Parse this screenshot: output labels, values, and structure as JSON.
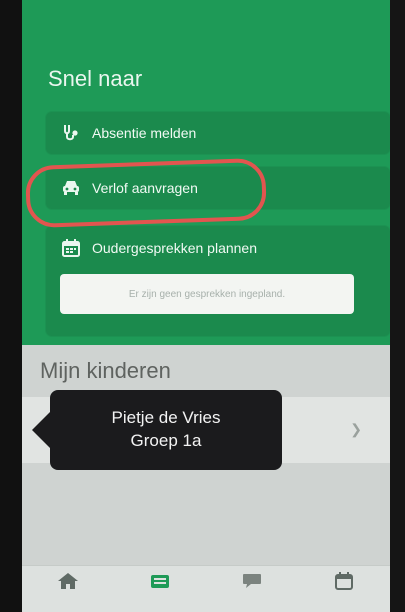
{
  "quick_links": {
    "title": "Snel naar",
    "items": [
      {
        "label": "Absentie melden",
        "icon": "stethoscope-icon"
      },
      {
        "label": "Verlof aanvragen",
        "icon": "car-icon"
      },
      {
        "label": "Oudergesprekken plannen",
        "icon": "calendar-icon",
        "empty_text": "Er zijn geen gesprekken ingepland."
      }
    ]
  },
  "children": {
    "title": "Mijn kinderen"
  },
  "tooltip": {
    "line1": "Pietje de Vries",
    "line2": "Groep 1a"
  },
  "nav": {
    "items": [
      {
        "label": "",
        "icon": "home-icon"
      },
      {
        "label": "",
        "icon": "inbox-icon"
      },
      {
        "label": "",
        "icon": "chat-icon"
      },
      {
        "label": "",
        "icon": "calendar-icon"
      }
    ]
  },
  "colors": {
    "green": "#1e9a57",
    "card_green": "#1b8a4d",
    "highlight_red": "#e2554f",
    "tooltip_bg": "#1b1b1d"
  }
}
